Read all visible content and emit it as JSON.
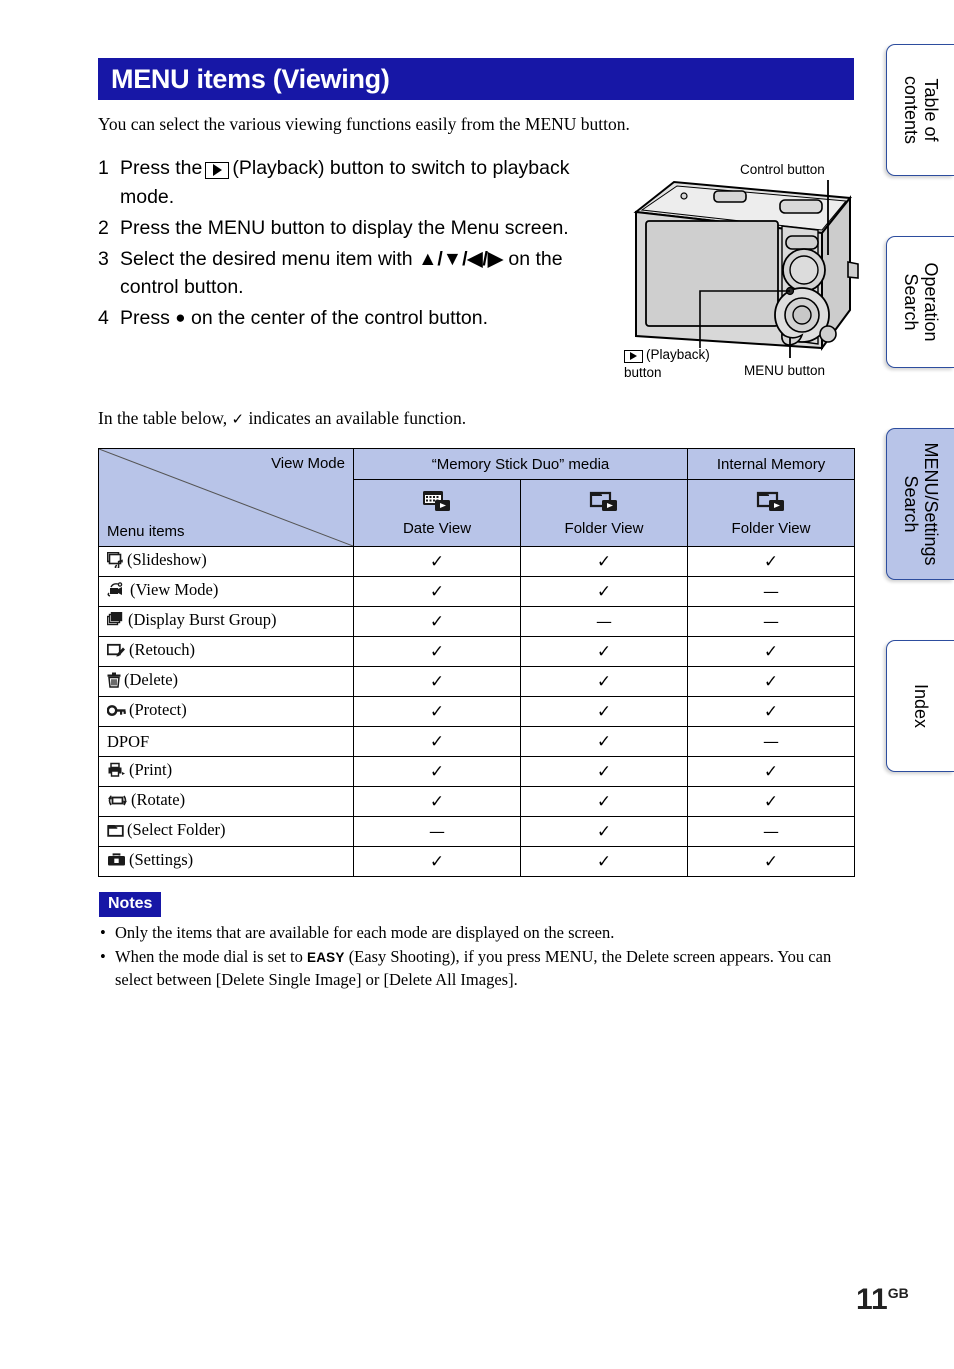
{
  "header": {
    "title": "MENU items (Viewing)",
    "banner_color": "#1717a6"
  },
  "intro": "You can select the various viewing functions easily from the MENU button.",
  "steps": [
    {
      "num": "1",
      "before_icon": "Press the",
      "icon": "playback-icon",
      "after_icon": "(Playback) button to switch to playback mode."
    },
    {
      "num": "2",
      "text": "Press the MENU button to display the Menu screen."
    },
    {
      "num": "3",
      "before_icon": "Select the desired menu item with",
      "arrows": "▲/▼/◀/▶",
      "after_icon": "on the control button."
    },
    {
      "num": "4",
      "before_icon": "Press",
      "dot": "●",
      "after_icon": "on the center of the control button."
    }
  ],
  "figure": {
    "control_button_label": "Control button",
    "menu_button_label": "MENU button",
    "playback_button_label_line1": "(Playback)",
    "playback_button_label_line2": "button"
  },
  "available_note": {
    "before": "In the table below,",
    "check": "✓",
    "after": "indicates an available function."
  },
  "table": {
    "corner": {
      "view_mode_label": "View Mode",
      "menu_items_label": "Menu items"
    },
    "group_headers": [
      {
        "label": "“Memory Stick Duo” media",
        "span": 2
      },
      {
        "label": "Internal Memory",
        "span": 1
      }
    ],
    "sub_headers": [
      {
        "icon": "date-view-icon",
        "label": "Date View"
      },
      {
        "icon": "folder-view-icon",
        "label": "Folder View"
      },
      {
        "icon": "folder-view-icon",
        "label": "Folder View"
      }
    ],
    "rows": [
      {
        "icon": "slideshow-icon",
        "label": "(Slideshow)",
        "values": [
          "✓",
          "✓",
          "✓"
        ]
      },
      {
        "icon": "view-mode-icon",
        "label": "(View Mode)",
        "values": [
          "✓",
          "✓",
          "—"
        ]
      },
      {
        "icon": "display-burst-group-icon",
        "label": "(Display Burst Group)",
        "values": [
          "✓",
          "—",
          "—"
        ]
      },
      {
        "icon": "retouch-icon",
        "label": "(Retouch)",
        "values": [
          "✓",
          "✓",
          "✓"
        ]
      },
      {
        "icon": "delete-icon",
        "label": "(Delete)",
        "values": [
          "✓",
          "✓",
          "✓"
        ]
      },
      {
        "icon": "protect-icon",
        "label": "(Protect)",
        "values": [
          "✓",
          "✓",
          "✓"
        ]
      },
      {
        "icon": "none",
        "label": "DPOF",
        "values": [
          "✓",
          "✓",
          "—"
        ]
      },
      {
        "icon": "print-icon",
        "label": "(Print)",
        "values": [
          "✓",
          "✓",
          "✓"
        ]
      },
      {
        "icon": "rotate-icon",
        "label": "(Rotate)",
        "values": [
          "✓",
          "✓",
          "✓"
        ]
      },
      {
        "icon": "select-folder-icon",
        "label": "(Select Folder)",
        "values": [
          "—",
          "✓",
          "—"
        ]
      },
      {
        "icon": "settings-icon",
        "label": "(Settings)",
        "values": [
          "✓",
          "✓",
          "✓"
        ]
      }
    ]
  },
  "notes": {
    "badge": "Notes",
    "items": [
      {
        "text": "Only the items that are available for each mode are displayed on the screen."
      },
      {
        "before": "When the mode dial is set to",
        "glyph": "EASY",
        "after": "(Easy Shooting), if you press MENU, the Delete screen appears. You can select between [Delete Single Image] or [Delete All Images]."
      }
    ]
  },
  "side_tabs": [
    {
      "label_line1": "Table of",
      "label_line2": "contents",
      "active": false
    },
    {
      "label_line1": "Operation",
      "label_line2": "Search",
      "active": false
    },
    {
      "label_line1": "MENU/Settings",
      "label_line2": "Search",
      "active": true
    },
    {
      "label_line1": "Index",
      "label_line2": "",
      "active": false
    }
  ],
  "page_number": {
    "number": "11",
    "suffix": "GB"
  }
}
